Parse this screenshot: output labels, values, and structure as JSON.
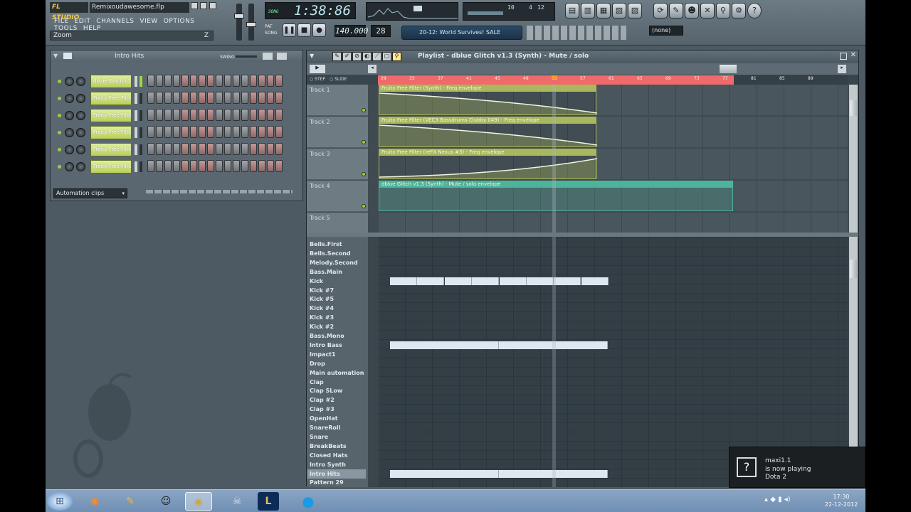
{
  "app": {
    "logo": "FL STUDIO",
    "project_file": "Remixoudawesome.flp",
    "menu": [
      "FILE",
      "EDIT",
      "CHANNELS",
      "VIEW",
      "OPTIONS",
      "TOOLS",
      "HELP"
    ],
    "hint": "Zoom",
    "hint_key": "Z",
    "time": "1:38:86",
    "time_label": "SONG",
    "tempo": "140.000",
    "pattern_num": "28",
    "news_ticker": "20-12: World Survives! SALE",
    "snap": "(none)",
    "cpu": "10",
    "poly": "4",
    "meter": "12"
  },
  "channel_rack": {
    "pattern_label": "Intro Hits",
    "swing_label": "SWING",
    "channels": [
      {
        "name": "dblue Glitch v1.3"
      },
      {
        "name": "Fruity Free Filter"
      },
      {
        "name": "Fruity Free Filter"
      },
      {
        "name": "Fruity Free Filter"
      },
      {
        "name": "Fruity Free Filter"
      },
      {
        "name": "Fruity Free Filter"
      }
    ],
    "automation_selector": "Automation clips"
  },
  "playlist": {
    "title": "Playlist - dblue Glitch v1.3 (Synth) - Mute / solo",
    "step_label": "STEP",
    "slide_label": "SLIDE",
    "ruler_ticks": [
      "29",
      "33",
      "37",
      "41",
      "45",
      "49",
      "53",
      "57",
      "61",
      "65",
      "69",
      "73",
      "77",
      "81",
      "85",
      "89"
    ],
    "tracks": [
      {
        "name": "Track 1",
        "clip": "Fruity Free Filter (Synth) - Freq envelope",
        "clip_length": 0.6,
        "color": "#a9b85a",
        "curve": "down"
      },
      {
        "name": "Track 2",
        "clip": "Fruity Free Filter (VEC3 Bassdrums Clubby 049) - Freq envelope",
        "clip_length": 0.6,
        "color": "#a9b85a",
        "curve": "down"
      },
      {
        "name": "Track 3",
        "clip": "Fruity Free Filter (reFX Nexus #3) - Freq envelope",
        "clip_length": 0.6,
        "color": "#a9b85a",
        "curve": "up"
      },
      {
        "name": "Track 4",
        "clip": "dblue Glitch v1.3 (Synth) - Mute / solo envelope",
        "clip_length": 0.99,
        "color": "#4db39a",
        "curve": "none"
      },
      {
        "name": "Track 5",
        "clip": "",
        "clip_length": 0,
        "color": "",
        "curve": "none"
      }
    ],
    "patterns": [
      {
        "name": "Bells.First",
        "blocks": []
      },
      {
        "name": "Bells.Second",
        "blocks": []
      },
      {
        "name": "Melody.Second ...",
        "blocks": []
      },
      {
        "name": "Bass.Main",
        "blocks": []
      },
      {
        "name": "Kick",
        "blocks": [
          [
            0,
            0.6
          ]
        ]
      },
      {
        "name": "Kick #7",
        "blocks": []
      },
      {
        "name": "Kick #5",
        "blocks": []
      },
      {
        "name": "Kick #4",
        "blocks": []
      },
      {
        "name": "Kick #3",
        "blocks": []
      },
      {
        "name": "Kick #2",
        "blocks": []
      },
      {
        "name": "Bass.Mono",
        "blocks": []
      },
      {
        "name": "Intro Bass",
        "blocks": [
          [
            0,
            0.6
          ]
        ]
      },
      {
        "name": "Impact1",
        "blocks": []
      },
      {
        "name": "Drop",
        "blocks": []
      },
      {
        "name": "Main automation",
        "blocks": []
      },
      {
        "name": "Clap",
        "blocks": []
      },
      {
        "name": "Clap SLow",
        "blocks": []
      },
      {
        "name": "Clap #2",
        "blocks": []
      },
      {
        "name": "Clap #3",
        "blocks": []
      },
      {
        "name": "OpenHat",
        "blocks": []
      },
      {
        "name": "SnareRoll",
        "blocks": []
      },
      {
        "name": "Snare",
        "blocks": []
      },
      {
        "name": "BreakBeats",
        "blocks": []
      },
      {
        "name": "Closed Hats",
        "blocks": []
      },
      {
        "name": "Intro Synth",
        "blocks": []
      },
      {
        "name": "Intro Hits",
        "blocks": [
          [
            0,
            0.6
          ]
        ],
        "selected": true
      },
      {
        "name": "Pattern 29",
        "blocks": []
      }
    ]
  },
  "notification": {
    "user": "maxi1.1",
    "line": "is now playing",
    "game": "Dota 2"
  },
  "taskbar": {
    "clock_time": "17:30",
    "clock_date": "22-12-2012"
  }
}
